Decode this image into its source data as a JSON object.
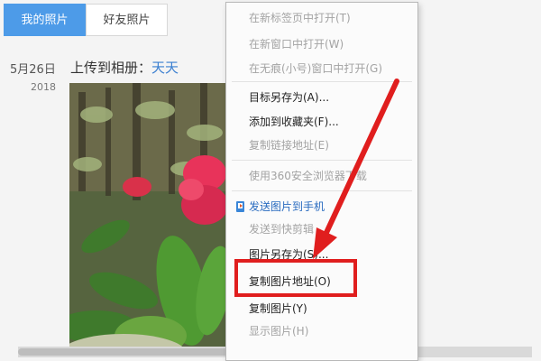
{
  "tabs": [
    {
      "label": "我的照片",
      "active": true
    },
    {
      "label": "好友照片",
      "active": false
    }
  ],
  "post": {
    "date_day": "5月26日",
    "date_year": "2018",
    "upload_prefix": "上传到相册：",
    "album_name": "天天"
  },
  "context_menu": {
    "items": [
      {
        "label": "在新标签页中打开(T)",
        "disabled": true
      },
      {
        "label": "在新窗口中打开(W)",
        "disabled": true
      },
      {
        "label": "在无痕(小号)窗口中打开(G)",
        "disabled": true
      },
      {
        "label": "目标另存为(A)...",
        "disabled": false
      },
      {
        "label": "添加到收藏夹(F)...",
        "disabled": false
      },
      {
        "label": "复制链接地址(E)",
        "disabled": true
      },
      {
        "label": "使用360安全浏览器下载",
        "disabled": true
      },
      {
        "label": "发送图片到手机",
        "disabled": false,
        "icon": "send-to-phone-icon"
      },
      {
        "label": "发送到快剪辑",
        "disabled": true
      },
      {
        "label": "图片另存为(S)...",
        "disabled": false
      },
      {
        "label": "复制图片地址(O)",
        "disabled": false
      },
      {
        "label": "复制图片(Y)",
        "disabled": false
      },
      {
        "label": "显示图片(H)",
        "disabled": true
      }
    ]
  },
  "annotation": {
    "highlight_color": "#e01e1e",
    "highlighted_item": "复制图片地址(O)"
  },
  "colors": {
    "active_tab": "#4d9be8",
    "link": "#3a7fd0"
  }
}
